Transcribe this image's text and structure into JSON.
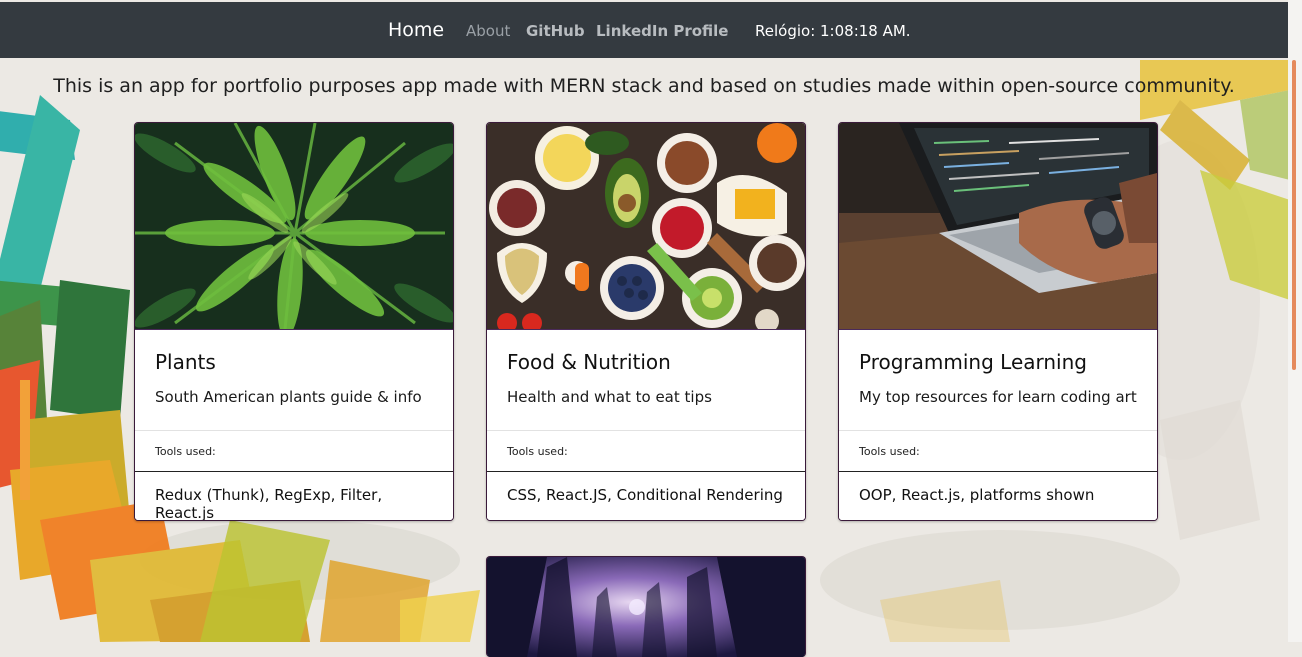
{
  "navbar": {
    "brand": "Home",
    "links": [
      {
        "label": "About"
      },
      {
        "label": "GitHub"
      },
      {
        "label": "LinkedIn Profile"
      }
    ],
    "clock": "Relógio: 1:08:18 AM."
  },
  "tagline": "This is an app for portfolio purposes app made with MERN stack and based on studies made within open-source community.",
  "cards": [
    {
      "image": "palm-leaves-photo",
      "title": "Plants",
      "text": "South American plants guide & info",
      "tools_label": "Tools used:",
      "tools": "Redux (Thunk), RegExp, Filter, React.js"
    },
    {
      "image": "healthy-food-photo",
      "title": "Food & Nutrition",
      "text": "Health and what to eat tips",
      "tools_label": "Tools used:",
      "tools": "CSS, React.JS, Conditional Rendering"
    },
    {
      "image": "laptop-coding-photo",
      "title": "Programming Learning",
      "text": "My top resources for learn coding art",
      "tools_label": "Tools used:",
      "tools": "OOP, React.js, platforms shown"
    },
    {
      "image": "purple-forest-photo"
    }
  ],
  "colors": {
    "navbar": "#343a40",
    "page_bg": "#ece9e4",
    "card_border": "#3a1a3a"
  }
}
